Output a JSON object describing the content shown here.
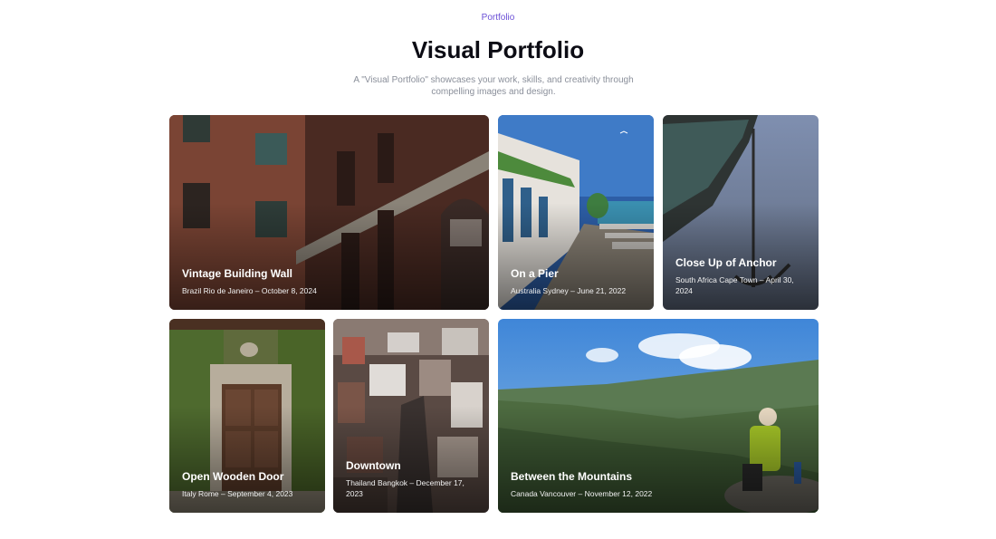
{
  "header": {
    "eyebrow": "Portfolio",
    "title": "Visual Portfolio",
    "subtitle": "A \"Visual Portfolio\" showcases your work, skills, and creativity through compelling images and design."
  },
  "cards": [
    {
      "title": "Vintage Building Wall",
      "subtitle": "Brazil Rio de Janeiro – October 8, 2024"
    },
    {
      "title": "On a Pier",
      "subtitle": "Australia Sydney – June 21, 2022"
    },
    {
      "title": "Close Up of Anchor",
      "subtitle": "South Africa Cape Town – April 30, 2024"
    },
    {
      "title": "Open Wooden Door",
      "subtitle": "Italy Rome – September 4, 2023"
    },
    {
      "title": "Downtown",
      "subtitle": "Thailand Bangkok – December 17, 2023"
    },
    {
      "title": "Between the Mountains",
      "subtitle": "Canada Vancouver – November 12, 2022"
    }
  ]
}
